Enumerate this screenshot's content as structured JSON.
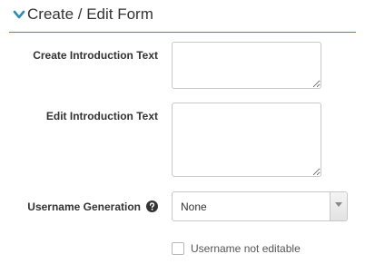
{
  "section": {
    "title": "Create / Edit Form",
    "icon": "chevron-down-icon",
    "accent_color": "#2a8fb0"
  },
  "fields": {
    "create_intro": {
      "label": "Create Introduction Text",
      "value": ""
    },
    "edit_intro": {
      "label": "Edit Introduction Text",
      "value": ""
    },
    "username_generation": {
      "label": "Username Generation",
      "help_icon": "question-circle-icon",
      "selected": "None"
    },
    "username_not_editable": {
      "label": "Username not editable",
      "checked": false
    }
  }
}
